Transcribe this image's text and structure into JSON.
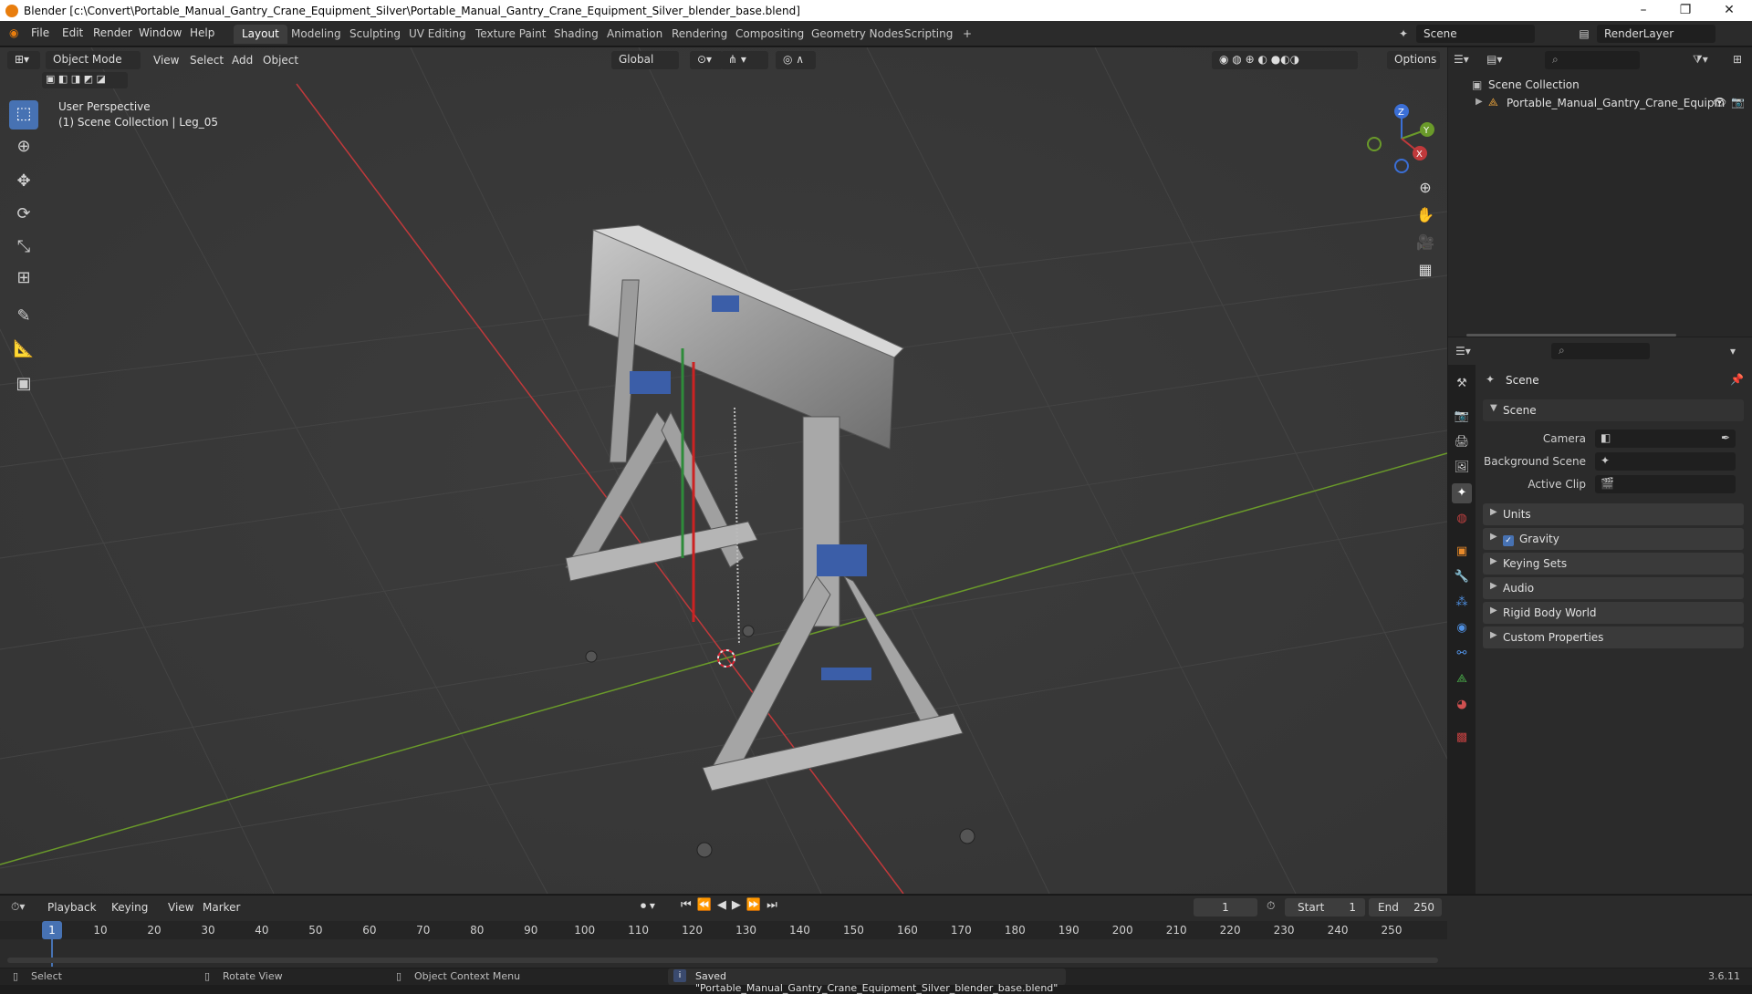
{
  "titlebar": {
    "title": "Blender [c:\\Convert\\Portable_Manual_Gantry_Crane_Equipment_Silver\\Portable_Manual_Gantry_Crane_Equipment_Silver_blender_base.blend]",
    "minimize": "–",
    "maximize": "❐",
    "close": "✕"
  },
  "menubar": {
    "items": [
      "File",
      "Edit",
      "Render",
      "Window",
      "Help"
    ],
    "workspaces": [
      "Layout",
      "Modeling",
      "Sculpting",
      "UV Editing",
      "Texture Paint",
      "Shading",
      "Animation",
      "Rendering",
      "Compositing",
      "Geometry Nodes",
      "Scripting"
    ],
    "active_workspace": "Layout",
    "add_tab": "+",
    "scene_label": "Scene",
    "render_layer": "RenderLayer"
  },
  "viewport": {
    "mode": "Object Mode",
    "menus": [
      "View",
      "Select",
      "Add",
      "Object"
    ],
    "orientation": "Global",
    "options": "Options",
    "overlay_title": "User Perspective",
    "overlay_subtitle": "(1) Scene Collection | Leg_05",
    "gizmo": {
      "z": "Z",
      "y": "Y",
      "x": "X"
    }
  },
  "outliner": {
    "root": "Scene Collection",
    "item": "Portable_Manual_Gantry_Crane_Equipm"
  },
  "properties": {
    "header": "Scene",
    "section": "Scene",
    "fields": [
      {
        "label": "Camera"
      },
      {
        "label": "Background Scene"
      },
      {
        "label": "Active Clip"
      }
    ],
    "panels": [
      "Units",
      "Gravity",
      "Keying Sets",
      "Audio",
      "Rigid Body World",
      "Custom Properties"
    ],
    "gravity_checked": true
  },
  "timeline": {
    "menus": [
      "Playback",
      "Keying",
      "View",
      "Marker"
    ],
    "current_frame": "1",
    "start_label": "Start",
    "start": "1",
    "end_label": "End",
    "end": "250",
    "frames": [
      "1",
      "10",
      "20",
      "30",
      "40",
      "50",
      "60",
      "70",
      "80",
      "90",
      "100",
      "110",
      "120",
      "130",
      "140",
      "150",
      "160",
      "170",
      "180",
      "190",
      "200",
      "210",
      "220",
      "230",
      "240",
      "250"
    ]
  },
  "statusbar": {
    "select": "Select",
    "rotate": "Rotate View",
    "context": "Object Context Menu",
    "message": "Saved \"Portable_Manual_Gantry_Crane_Equipment_Silver_blender_base.blend\"",
    "version": "3.6.11"
  }
}
